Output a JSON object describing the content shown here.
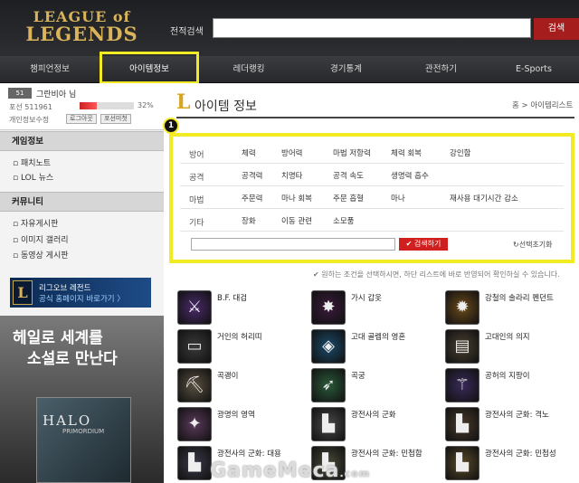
{
  "header": {
    "logo_line1": "LEAGUE of",
    "logo_line2": "LEGENDS",
    "search_label": "전적검색",
    "search_button": "검색"
  },
  "nav": [
    "챔피언정보",
    "아이템정보",
    "레더랭킹",
    "경기통계",
    "관전하기",
    "E-Sports"
  ],
  "nav_active": "아이템정보",
  "profile": {
    "level": "51",
    "name": "그란비아 님",
    "tier": "포선 511961",
    "exp_percent": "32%",
    "exp_fraction": 0.32,
    "edit": "개인정보수정",
    "btn_logout": "로그아웃",
    "btn_mypage": "포선미첫"
  },
  "sidebar": {
    "game_title": "게임정보",
    "game_links": [
      "패치노트",
      "LOL 뉴스"
    ],
    "community_title": "커뮤니티",
    "community_links": [
      "자유게시판",
      "이미지 갤러리",
      "동영상 게시판"
    ],
    "banner1_title": "리그오브 레전드",
    "banner1_sub": "공식 홈페이지 바로가기 〉",
    "banner2_line1": "헤일로 세계를",
    "banner2_line2": "소설로 만난다",
    "banner2_box": "HALO",
    "banner2_box_sub": "PRIMORDIUM"
  },
  "main": {
    "title": "아이템 정보",
    "breadcrumb": "홈 > 아이템리스트",
    "step_badge": "1"
  },
  "filters": [
    {
      "category": "방어",
      "options": [
        "체력",
        "방어력",
        "마법 저항력",
        "체력 회복",
        "강인함"
      ]
    },
    {
      "category": "공격",
      "options": [
        "공격력",
        "치명타",
        "공격 속도",
        "생명력 흡수"
      ]
    },
    {
      "category": "마법",
      "options": [
        "주문력",
        "마나 회복",
        "주문 흡혈",
        "마나",
        "재사용 대기시간 감소"
      ]
    },
    {
      "category": "기타",
      "options": [
        "장화",
        "이동 관련",
        "소모품"
      ]
    }
  ],
  "search_button": "✔ 검색하기",
  "reset_link": "↻선택초기화",
  "note": "✔ 원하는 조건을 선택하시면, 하단 리스트에 바로 반영되어 확인하실 수 있습니다.",
  "items": [
    "B.F. 대검",
    "가시 갑옷",
    "강철의 솔라리 펜던트",
    "거인의 허리띠",
    "고대 골렘의 영혼",
    "고대인의 의지",
    "곡괭이",
    "곡궁",
    "공허의 지팡이",
    "광명의 영역",
    "광전사의 군화",
    "광전사의 군화: 격노",
    "광전사의 군화: 대용",
    "광전사의 군화: 민첩함",
    "광전사의 군화: 민첩성"
  ],
  "item_icons": [
    "sword-icon",
    "spiked-armor-icon",
    "pendant-icon",
    "belt-icon",
    "golem-icon",
    "tome-icon",
    "pickaxe-icon",
    "bow-icon",
    "staff-icon",
    "light-icon",
    "boots-icon",
    "boots-icon",
    "boots-icon",
    "boots-icon",
    "boots-icon"
  ],
  "watermark": "GameMeca",
  "watermark_suffix": ".com",
  "colors": {
    "highlight": "#f2ea22",
    "accent_red": "#cf1f1f",
    "brand_gold": "#d9b45a"
  }
}
